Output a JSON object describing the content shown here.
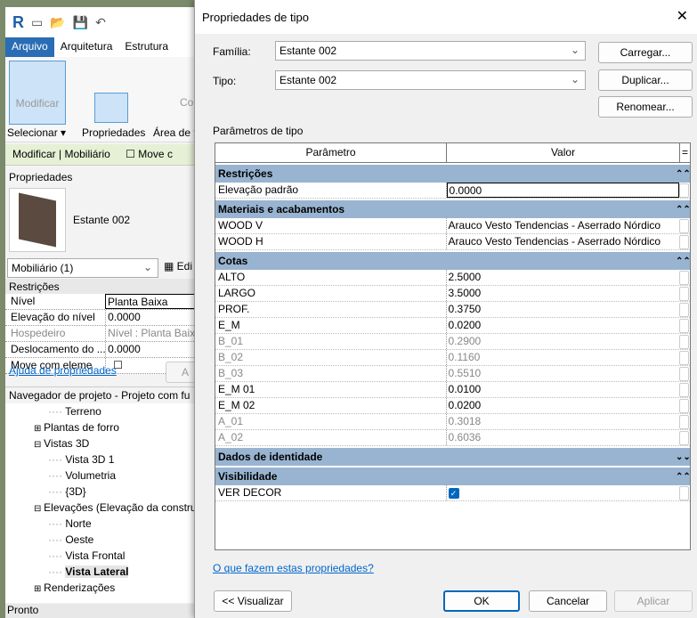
{
  "app": {
    "logo": "R",
    "tabs": [
      "Arquivo",
      "Arquitetura",
      "Estrutura"
    ],
    "ribbon": {
      "modify": "Modificar",
      "select": "Selecionar ▾",
      "properties": "Propriedades",
      "area": "Área de t",
      "co": "Co"
    },
    "context": "Modificar | Mobiliário",
    "move_label": "Move c",
    "props": {
      "title": "Propriedades",
      "type_name": "Estante 002",
      "selector": "Mobiliário (1)",
      "edit": "Edi",
      "section": "Restrições",
      "rows": [
        [
          "Nível",
          "Planta Baixa"
        ],
        [
          "Elevação do nível",
          "0.0000"
        ],
        [
          "Hospedeiro",
          "Nível : Planta Baix"
        ],
        [
          "Deslocamento do ...",
          "0.0000"
        ],
        [
          "Move com eleme",
          ""
        ]
      ],
      "help": "Ajuda de propriedades",
      "apply": "A"
    },
    "browser": {
      "title": "Navegador de projeto - Projeto com fu",
      "items": [
        {
          "label": "Terreno",
          "level": 2
        },
        {
          "label": "Plantas de forro",
          "level": 1,
          "toggle": "+"
        },
        {
          "label": "Vistas 3D",
          "level": 1,
          "toggle": "−"
        },
        {
          "label": "Vista 3D 1",
          "level": 2
        },
        {
          "label": "Volumetria",
          "level": 2
        },
        {
          "label": "{3D}",
          "level": 2
        },
        {
          "label": "Elevações (Elevação da constru",
          "level": 1,
          "toggle": "−"
        },
        {
          "label": "Norte",
          "level": 2
        },
        {
          "label": "Oeste",
          "level": 2
        },
        {
          "label": "Vista Frontal",
          "level": 2
        },
        {
          "label": "Vista Lateral",
          "level": 2,
          "selected": true
        },
        {
          "label": "Renderizações",
          "level": 1,
          "toggle": "+"
        }
      ]
    },
    "status": "Pronto"
  },
  "dialog": {
    "title": "Propriedades de tipo",
    "family_label": "Família:",
    "family": "Estante 002",
    "type_label": "Tipo:",
    "type": "Estante 002",
    "load": "Carregar...",
    "duplicate": "Duplicar...",
    "rename": "Renomear...",
    "params_label": "Parâmetros de tipo",
    "col_param": "Parâmetro",
    "col_value": "Valor",
    "col_eq": "=",
    "groups": [
      {
        "name": "Restrições",
        "collapsed": false,
        "rows": [
          {
            "p": "Elevação padrão",
            "v": "0.0000",
            "edit": true
          }
        ]
      },
      {
        "name": "Materiais e acabamentos",
        "collapsed": false,
        "rows": [
          {
            "p": "WOOD V",
            "v": "Arauco Vesto Tendencias - Aserrado Nórdico"
          },
          {
            "p": "WOOD H",
            "v": "Arauco Vesto Tendencias - Aserrado Nórdico"
          }
        ]
      },
      {
        "name": "Cotas",
        "collapsed": false,
        "rows": [
          {
            "p": "ALTO",
            "v": "2.5000"
          },
          {
            "p": "LARGO",
            "v": "3.5000"
          },
          {
            "p": "PROF.",
            "v": "0.3750"
          },
          {
            "p": "E_M",
            "v": "0.0200"
          },
          {
            "p": "B_01",
            "v": "0.2900",
            "ro": true
          },
          {
            "p": "B_02",
            "v": "0.1160",
            "ro": true
          },
          {
            "p": "B_03",
            "v": "0.5510",
            "ro": true
          },
          {
            "p": "E_M 01",
            "v": "0.0100"
          },
          {
            "p": "E_M 02",
            "v": "0.0200"
          },
          {
            "p": "A_01",
            "v": "0.3018",
            "ro": true
          },
          {
            "p": "A_02",
            "v": "0.6036",
            "ro": true
          }
        ]
      },
      {
        "name": "Dados de identidade",
        "collapsed": true,
        "rows": []
      },
      {
        "name": "Visibilidade",
        "collapsed": false,
        "rows": [
          {
            "p": "VER DECOR",
            "checkbox": true,
            "checked": true
          }
        ]
      }
    ],
    "help_link": "O que fazem estas propriedades?",
    "preview": "<< Visualizar",
    "ok": "OK",
    "cancel": "Cancelar",
    "apply": "Aplicar"
  }
}
